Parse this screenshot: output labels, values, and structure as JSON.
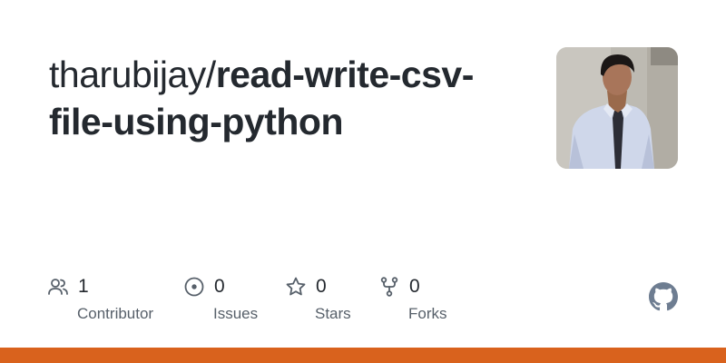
{
  "repo": {
    "owner": "tharubijay",
    "separator": "/",
    "name": "read-write-csv-file-using-python"
  },
  "stats": [
    {
      "icon": "people-icon",
      "count": "1",
      "label": "Contributor"
    },
    {
      "icon": "issue-circle-icon",
      "count": "0",
      "label": "Issues"
    },
    {
      "icon": "star-icon",
      "count": "0",
      "label": "Stars"
    },
    {
      "icon": "fork-icon",
      "count": "0",
      "label": "Forks"
    }
  ],
  "logo": "github-logo-icon",
  "colors": {
    "text": "#24292f",
    "muted": "#57606a",
    "icon": "#57606a",
    "accent_bar": "#d9621d"
  }
}
